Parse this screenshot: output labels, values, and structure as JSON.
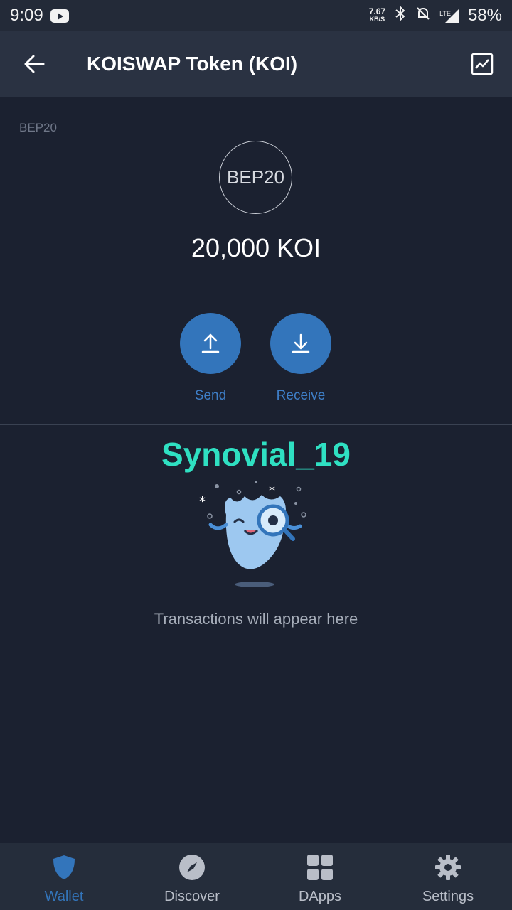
{
  "status_bar": {
    "time": "9:09",
    "net_speed": "7.67",
    "net_unit": "KB/S",
    "network_type": "LTE",
    "battery": "58%"
  },
  "header": {
    "title": "KOISWAP Token (KOI)",
    "back_icon": "arrow-left-icon",
    "chart_icon": "chart-icon"
  },
  "token": {
    "network_label": "BEP20",
    "logo_text": "BEP20",
    "balance": "20,000 KOI"
  },
  "actions": {
    "send_label": "Send",
    "receive_label": "Receive"
  },
  "watermark": "Synovial_19",
  "transactions": {
    "empty_text": "Transactions will appear here"
  },
  "nav": {
    "items": [
      {
        "label": "Wallet",
        "icon": "shield-icon",
        "active": true
      },
      {
        "label": "Discover",
        "icon": "compass-icon",
        "active": false
      },
      {
        "label": "DApps",
        "icon": "grid-icon",
        "active": false
      },
      {
        "label": "Settings",
        "icon": "gear-icon",
        "active": false
      }
    ]
  },
  "colors": {
    "background": "#1b2130",
    "app_bar": "#2a3242",
    "accent": "#3375bb",
    "watermark": "#2fe0c2"
  }
}
